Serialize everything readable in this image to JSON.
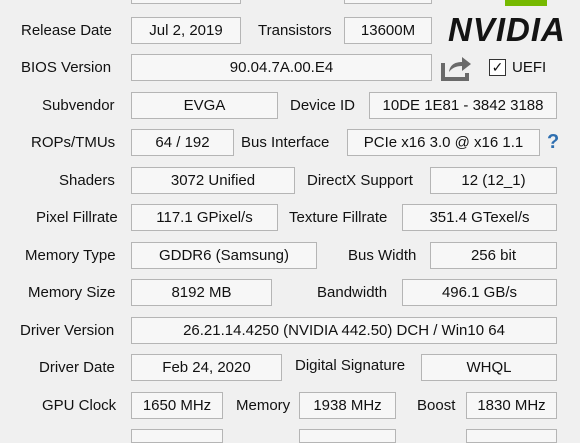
{
  "rows": {
    "release_date": {
      "label": "Release Date",
      "value": "Jul 2, 2019"
    },
    "transistors": {
      "label": "Transistors",
      "value": "13600M"
    },
    "bios_version": {
      "label": "BIOS Version",
      "value": "90.04.7A.00.E4"
    },
    "uefi": {
      "label": "UEFI",
      "checked": true
    },
    "subvendor": {
      "label": "Subvendor",
      "value": "EVGA"
    },
    "device_id": {
      "label": "Device ID",
      "value": "10DE 1E81 - 3842 3188"
    },
    "rops_tmus": {
      "label": "ROPs/TMUs",
      "value": "64 / 192"
    },
    "bus_interface": {
      "label": "Bus Interface",
      "value": "PCIe x16 3.0 @ x16 1.1"
    },
    "shaders": {
      "label": "Shaders",
      "value": "3072 Unified"
    },
    "directx": {
      "label": "DirectX Support",
      "value": "12 (12_1)"
    },
    "pixel_fillrate": {
      "label": "Pixel Fillrate",
      "value": "117.1 GPixel/s"
    },
    "texture_fillrate": {
      "label": "Texture Fillrate",
      "value": "351.4 GTexel/s"
    },
    "memory_type": {
      "label": "Memory Type",
      "value": "GDDR6 (Samsung)"
    },
    "bus_width": {
      "label": "Bus Width",
      "value": "256 bit"
    },
    "memory_size": {
      "label": "Memory Size",
      "value": "8192 MB"
    },
    "bandwidth": {
      "label": "Bandwidth",
      "value": "496.1 GB/s"
    },
    "driver_version": {
      "label": "Driver Version",
      "value": "26.21.14.4250 (NVIDIA 442.50) DCH / Win10 64"
    },
    "driver_date": {
      "label": "Driver Date",
      "value": "Feb 24, 2020"
    },
    "digital_signature": {
      "label": "Digital Signature",
      "value": "WHQL"
    },
    "gpu_clock": {
      "label": "GPU Clock",
      "value": "1650 MHz"
    },
    "memory_clock": {
      "label": "Memory",
      "value": "1938 MHz"
    },
    "boost": {
      "label": "Boost",
      "value": "1830 MHz"
    }
  },
  "logo": {
    "text": "NVIDIA"
  },
  "help_glyph": "?",
  "icons": {
    "share": "share-export-icon",
    "help": "question-icon",
    "checkbox": "checkmark-icon"
  },
  "colors": {
    "nvidia_green": "#76b900",
    "help_blue": "#2f6fb0"
  }
}
